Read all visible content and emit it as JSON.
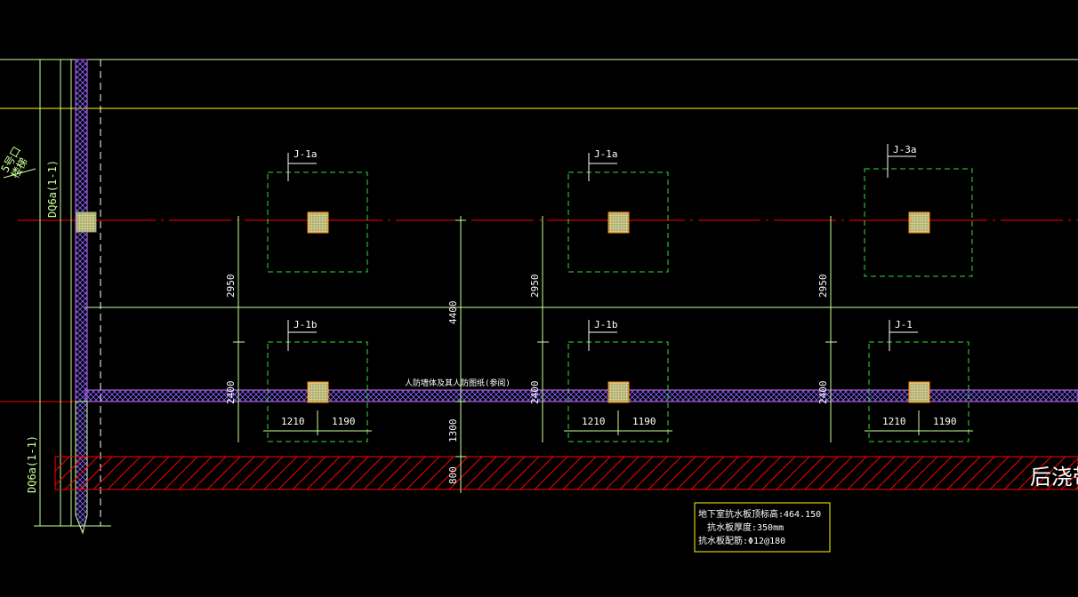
{
  "footings": {
    "col1_top": "J-1a",
    "col2_top": "J-1a",
    "col3_top": "J-3a",
    "col1_bot": "J-1b",
    "col2_bot": "J-1b",
    "col3_bot": "J-1"
  },
  "dimensions": {
    "d2950": "2950",
    "d2400": "2400",
    "d1210": "1210",
    "d1190": "1190",
    "d4400": "4400",
    "d1300": "1300",
    "d800": "800"
  },
  "wall_labels": {
    "top_tag": "DQ6a(1-1)",
    "bottom_tag": "DQ6a(1-1)",
    "corner_tag": "5号口\n楼梯"
  },
  "texts": {
    "wall_line_note": "人防墙体及其人防图纸(参阅)",
    "post_pour_band": "后浇带"
  },
  "info_box": {
    "line1": "地下室抗水板顶标高:464.150",
    "line2": "抗水板厚度:350mm",
    "line3": "抗水板配筋:Φ12@180"
  },
  "colors": {
    "background": "#000000",
    "yellow": "#ffff00",
    "red": "#ff0000",
    "green": "#00ff00",
    "light_green": "#ccff99",
    "magenta": "#cc66ff",
    "white": "#ffffff",
    "column_fill": "#e8d8a0"
  }
}
